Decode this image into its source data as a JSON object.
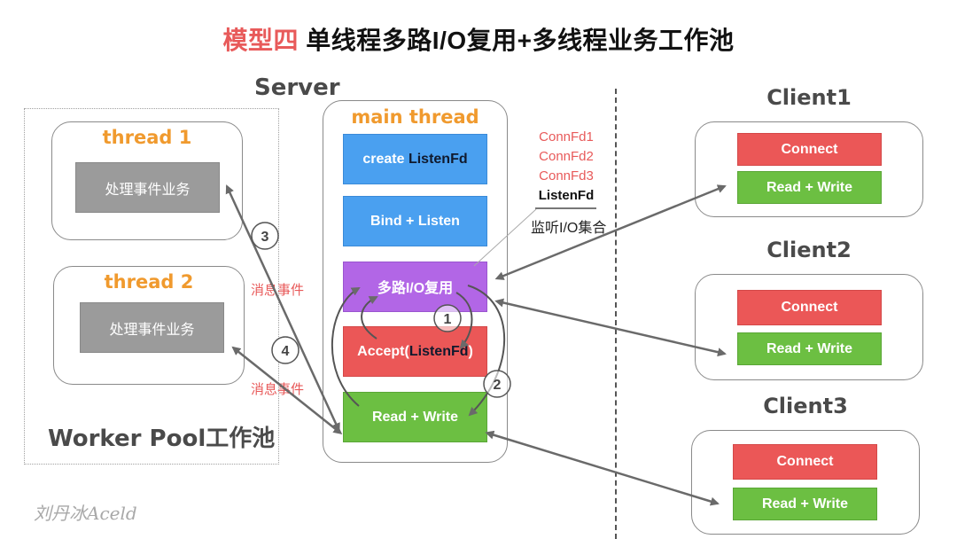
{
  "title": {
    "prefix": "模型四",
    "main": "单线程多路I/O复用+多线程业务工作池"
  },
  "server": {
    "label": "Server",
    "main_thread": {
      "label": "main thread",
      "blocks": {
        "create": {
          "text": "create ",
          "strong": "ListenFd"
        },
        "bind": "Bind + Listen",
        "mux": "多路I/O复用",
        "accept": {
          "prefix": "Accept(",
          "strong": "ListenFd",
          "suffix": ")"
        },
        "rw": "Read + Write"
      }
    }
  },
  "fd_set": {
    "items": [
      "ConnFd1",
      "ConnFd2",
      "ConnFd3"
    ],
    "listen": "ListenFd",
    "caption": "监听I/O集合"
  },
  "worker_pool": {
    "label": "Worker Pool工作池",
    "threads": [
      {
        "label": "thread 1",
        "task": "处理事件业务"
      },
      {
        "label": "thread 2",
        "task": "处理事件业务"
      }
    ]
  },
  "messages": [
    "消息事件",
    "消息事件"
  ],
  "steps": [
    "1",
    "2",
    "3",
    "4"
  ],
  "clients": [
    {
      "label": "Client1",
      "connect": "Connect",
      "rw": "Read + Write"
    },
    {
      "label": "Client2",
      "connect": "Connect",
      "rw": "Read + Write"
    },
    {
      "label": "Client3",
      "connect": "Connect",
      "rw": "Read + Write"
    }
  ],
  "watermark": "刘丹冰Aceld",
  "colors": {
    "accent_red": "#e85a5a",
    "blue": "#4aa0f0",
    "purple": "#b266e6",
    "red": "#eb5757",
    "green": "#6cbf42",
    "orange": "#f09a2e",
    "gray": "#9b9b9b"
  }
}
